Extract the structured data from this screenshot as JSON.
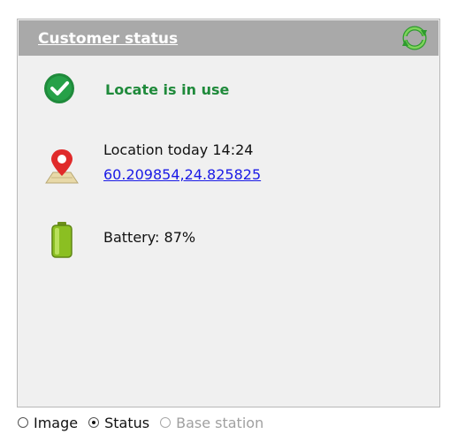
{
  "panel": {
    "title": "Customer status",
    "refresh_icon": "refresh-icon"
  },
  "status": {
    "text": "Locate is in use",
    "icon": "check-circle-icon",
    "color": "#1f8a3b"
  },
  "location": {
    "label": "Location today 14:24",
    "coordinates": "60.209854,24.825825",
    "icon": "map-pin-icon"
  },
  "battery": {
    "label": "Battery: 87%",
    "icon": "battery-icon"
  },
  "view_options": {
    "options": [
      {
        "label": "Image",
        "checked": false,
        "enabled": true
      },
      {
        "label": "Status",
        "checked": true,
        "enabled": true
      },
      {
        "label": "Base station",
        "checked": false,
        "enabled": false
      }
    ]
  }
}
